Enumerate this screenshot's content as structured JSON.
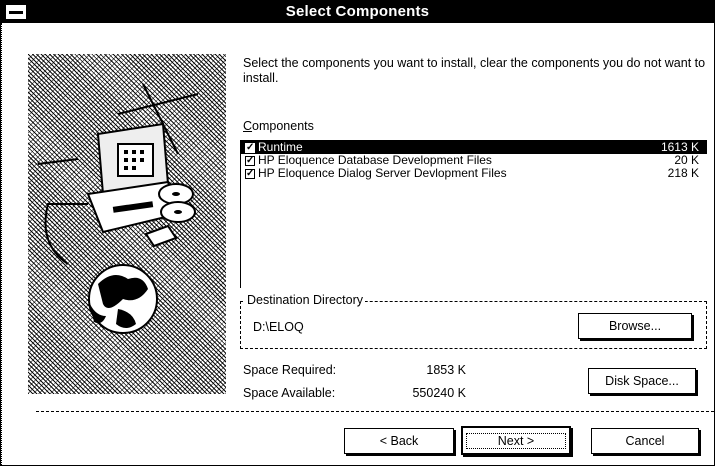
{
  "window": {
    "title": "Select Components"
  },
  "instructions": "Select the components you want to install, clear the components you do not want to install.",
  "components": {
    "label": "Components",
    "items": [
      {
        "name": "Runtime",
        "size": "1613 K",
        "checked": true,
        "selected": true
      },
      {
        "name": "HP Eloquence Database Development Files",
        "size": "20 K",
        "checked": true,
        "selected": false
      },
      {
        "name": "HP Eloquence Dialog Server Devlopment Files",
        "size": "218 K",
        "checked": true,
        "selected": false
      }
    ]
  },
  "destination": {
    "label": "Destination Directory",
    "path": "D:\\ELOQ",
    "browse_label": "Browse..."
  },
  "space": {
    "required_label": "Space Required:",
    "required_value": "1853 K",
    "available_label": "Space Available:",
    "available_value": "550240 K",
    "disk_space_label": "Disk Space..."
  },
  "nav": {
    "back_label": "< Back",
    "next_label": "Next >",
    "cancel_label": "Cancel"
  },
  "icons": {
    "system_menu": "system-menu-icon",
    "checkbox": "checkmark-icon"
  }
}
